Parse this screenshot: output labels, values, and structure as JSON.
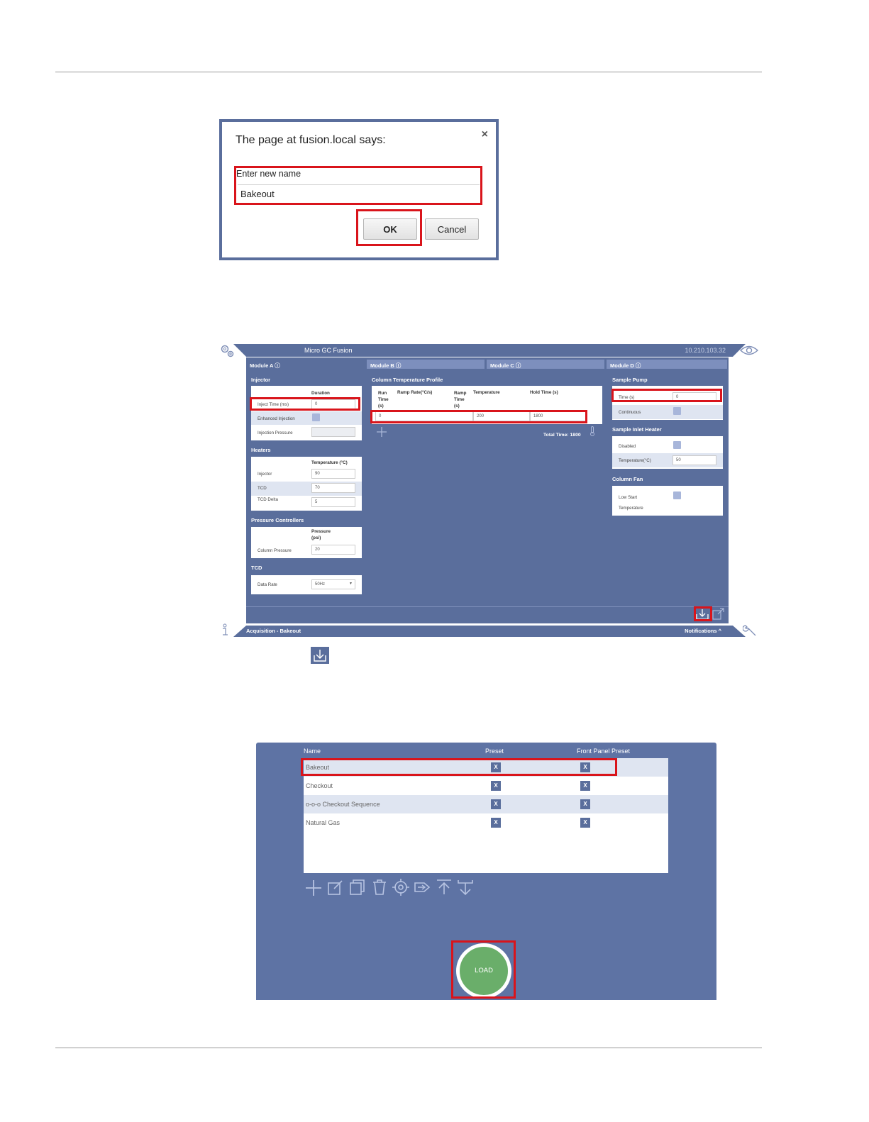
{
  "dialog": {
    "title": "The page at fusion.local says:",
    "close": "×",
    "prompt": "Enter new name",
    "value": "Bakeout",
    "ok_label": "OK",
    "cancel_label": "Cancel"
  },
  "app": {
    "title": "Micro GC Fusion",
    "ip": "10.210.103.32",
    "tabs": [
      "Module A",
      "Module B",
      "Module C",
      "Module D"
    ],
    "injector": {
      "heading": "Injector",
      "col": "Duration",
      "rows": [
        {
          "label": "Inject Time (ms)",
          "value": "0"
        },
        {
          "label": "Enhanced Injection"
        },
        {
          "label": "Injection Pressure",
          "value": ""
        }
      ]
    },
    "heaters": {
      "heading": "Heaters",
      "col": "Temperature (°C)",
      "rows": [
        {
          "label": "Injector",
          "value": "90"
        },
        {
          "label": "TCD",
          "value": "70"
        },
        {
          "label": "TCD Delta",
          "value": "5"
        }
      ]
    },
    "pressure": {
      "heading": "Pressure Controllers",
      "col_line1": "Pressure",
      "col_line2": "(psi)",
      "rows": [
        {
          "label": "Column Pressure",
          "value": "20"
        }
      ]
    },
    "tcd": {
      "heading": "TCD",
      "rows": [
        {
          "label": "Data Rate",
          "value": "50Hz"
        }
      ]
    },
    "column_profile": {
      "heading": "Column Temperature Profile",
      "cols": [
        "Run Time (s)",
        "Ramp Rate(°C/s)",
        "Ramp Time (s)",
        "Temperature",
        "Hold Time (s)"
      ],
      "row": {
        "run_time": "0",
        "temperature": "200",
        "hold_time": "1800"
      },
      "total": "Total Time: 1800"
    },
    "sample_pump": {
      "heading": "Sample Pump",
      "rows": [
        {
          "label": "Time (s)",
          "value": "0"
        },
        {
          "label": "Continuous"
        }
      ]
    },
    "inlet_heater": {
      "heading": "Sample Inlet Heater",
      "rows": [
        {
          "label": "Disabled"
        },
        {
          "label": "Temperature(°C)",
          "value": "50"
        }
      ]
    },
    "column_fan": {
      "heading": "Column Fan",
      "rows": [
        {
          "label_line1": "Low Start",
          "label_line2": "Temperature"
        }
      ]
    },
    "status": "Acquisition - Bakeout",
    "notifications": "Notifications ^"
  },
  "presets": {
    "headers": {
      "name": "Name",
      "preset": "Preset",
      "front_panel": "Front Panel Preset"
    },
    "rows": [
      {
        "name": "Bakeout"
      },
      {
        "name": "Checkout"
      },
      {
        "name": "o-o-o Checkout Sequence"
      },
      {
        "name": "Natural Gas"
      }
    ],
    "x_label": "X",
    "load_label": "LOAD"
  },
  "icons": [
    "gear-icon",
    "eye-icon",
    "info-icon",
    "wrench-icon",
    "save-icon",
    "export-icon",
    "add-icon",
    "edit-icon",
    "copy-icon",
    "delete-icon",
    "target-icon",
    "send-icon",
    "upload-icon",
    "download-icon"
  ],
  "colors": {
    "accent": "#5a6e9c",
    "highlight": "#d9141b",
    "load": "#6aae6a"
  }
}
